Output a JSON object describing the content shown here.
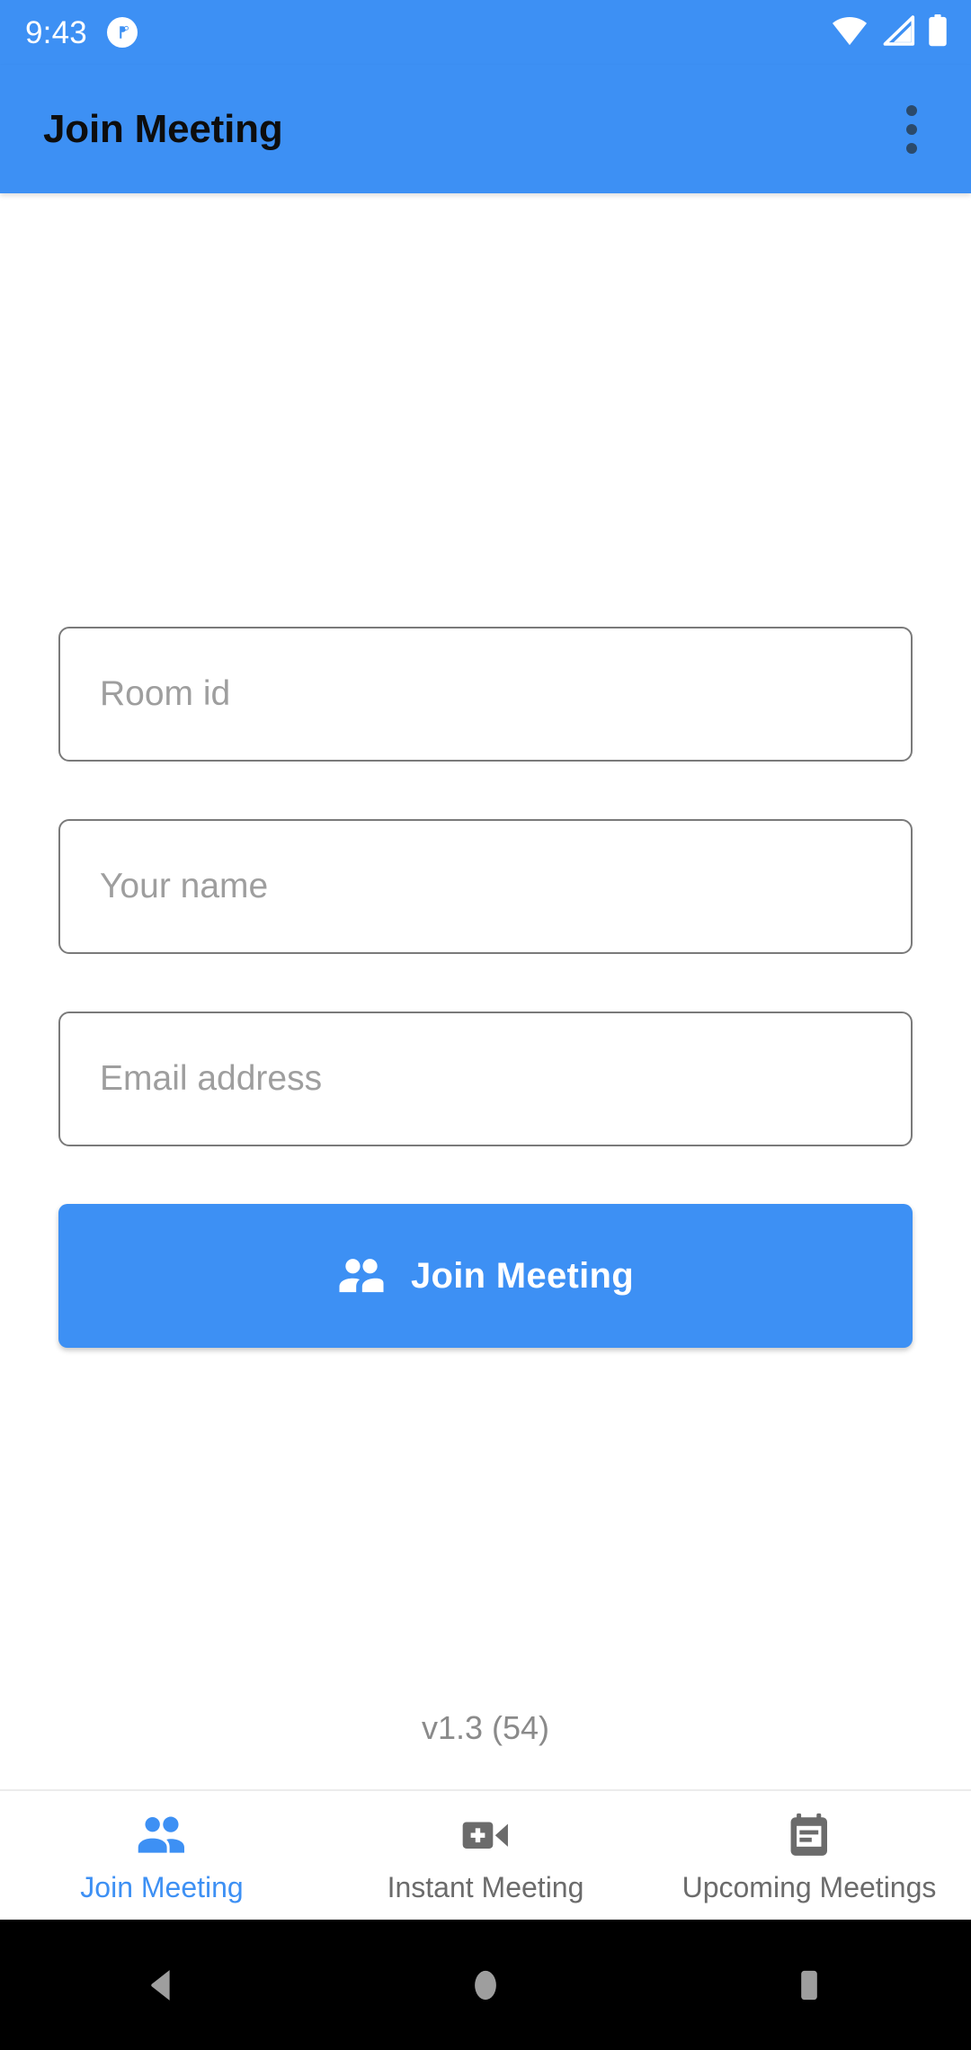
{
  "status_bar": {
    "time": "9:43",
    "notification_icon": "app-notification-icon",
    "wifi_icon": "wifi-full-icon",
    "cellular_icon": "cellular-signal-icon",
    "battery_icon": "battery-full-icon",
    "background_color": "#3D90F4",
    "foreground_color": "#FFFFFF"
  },
  "app_bar": {
    "title": "Join Meeting",
    "overflow_icon": "more-vert-icon",
    "background_color": "#3D90F4",
    "title_color": "#0D0D0D"
  },
  "form": {
    "room_id": {
      "placeholder": "Room id",
      "value": ""
    },
    "name": {
      "placeholder": "Your name",
      "value": ""
    },
    "email": {
      "placeholder": "Email address",
      "value": ""
    },
    "submit": {
      "label": "Join Meeting",
      "icon": "people-icon",
      "background_color": "#3D90F4",
      "text_color": "#FFFFFF"
    }
  },
  "version": {
    "text": "v1.3 (54)",
    "color": "#8A8A8A"
  },
  "bottom_nav": {
    "active_color": "#3D90F4",
    "inactive_color": "#6B6B6B",
    "tabs": [
      {
        "label": "Join Meeting",
        "icon": "people-icon",
        "active": true
      },
      {
        "label": "Instant Meeting",
        "icon": "video-call-add-icon",
        "active": false
      },
      {
        "label": "Upcoming Meetings",
        "icon": "calendar-event-icon",
        "active": false
      }
    ]
  },
  "system_nav": {
    "back": "back-triangle-icon",
    "home": "home-circle-icon",
    "recents": "recents-square-icon",
    "background_color": "#000000",
    "icon_color": "#9E9E9E"
  }
}
